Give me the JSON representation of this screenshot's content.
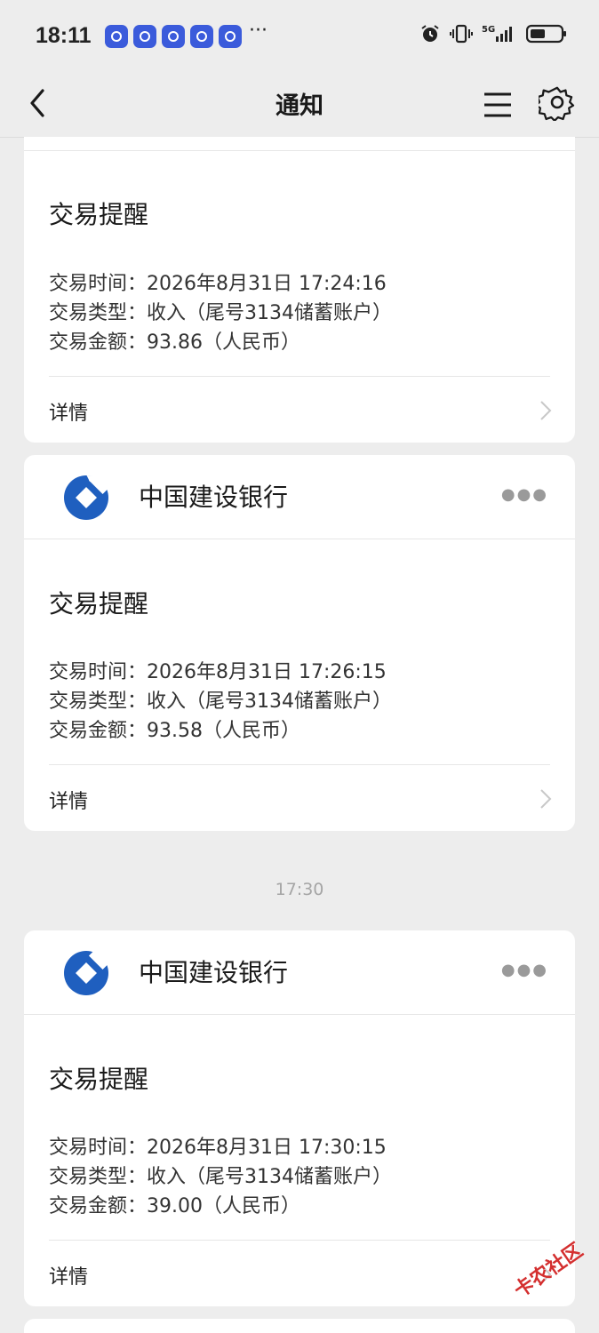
{
  "status_bar": {
    "time": "18:11",
    "more": "···"
  },
  "header": {
    "title": "通知"
  },
  "cards": [
    {
      "title": "交易提醒",
      "lines": [
        "交易时间：2026年8月31日 17:24:16",
        "交易类型：收入（尾号3134储蓄账户）",
        "交易金额：93.86（人民币）"
      ],
      "detail": "详情"
    },
    {
      "bank": "中国建设银行",
      "title": "交易提醒",
      "lines": [
        "交易时间：2026年8月31日 17:26:15",
        "交易类型：收入（尾号3134储蓄账户）",
        "交易金额：93.58（人民币）"
      ],
      "detail": "详情"
    },
    {
      "bank": "中国建设银行",
      "title": "交易提醒",
      "lines": [
        "交易时间：2026年8月31日 17:30:15",
        "交易类型：收入（尾号3134储蓄账户）",
        "交易金额：39.00（人民币）"
      ],
      "detail": "详情"
    }
  ],
  "timestamp": "17:30",
  "watermark": "卡农社区",
  "colors": {
    "brand": "#1f5fbf",
    "background": "#ededed",
    "watermark": "#d42f2f"
  }
}
